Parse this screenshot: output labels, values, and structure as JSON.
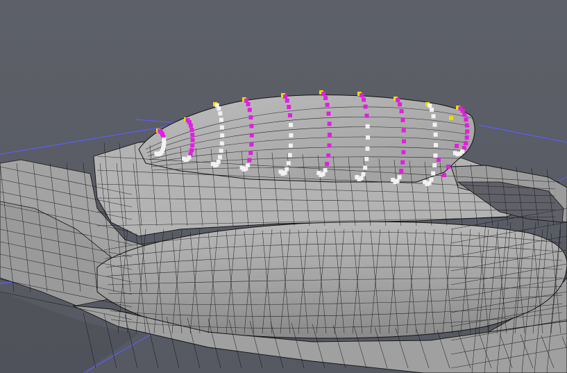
{
  "viewport": {
    "background": "#5b5e66",
    "grid_color": "#5c5cff",
    "mesh_fill": "#a9a9a9",
    "mesh_shadow": "#8a8a8a",
    "wire_color": "#111111",
    "selection_colors": {
      "white": "#f2f2f2",
      "magenta": "#e21ee0",
      "yellow": "#e6e000"
    }
  }
}
